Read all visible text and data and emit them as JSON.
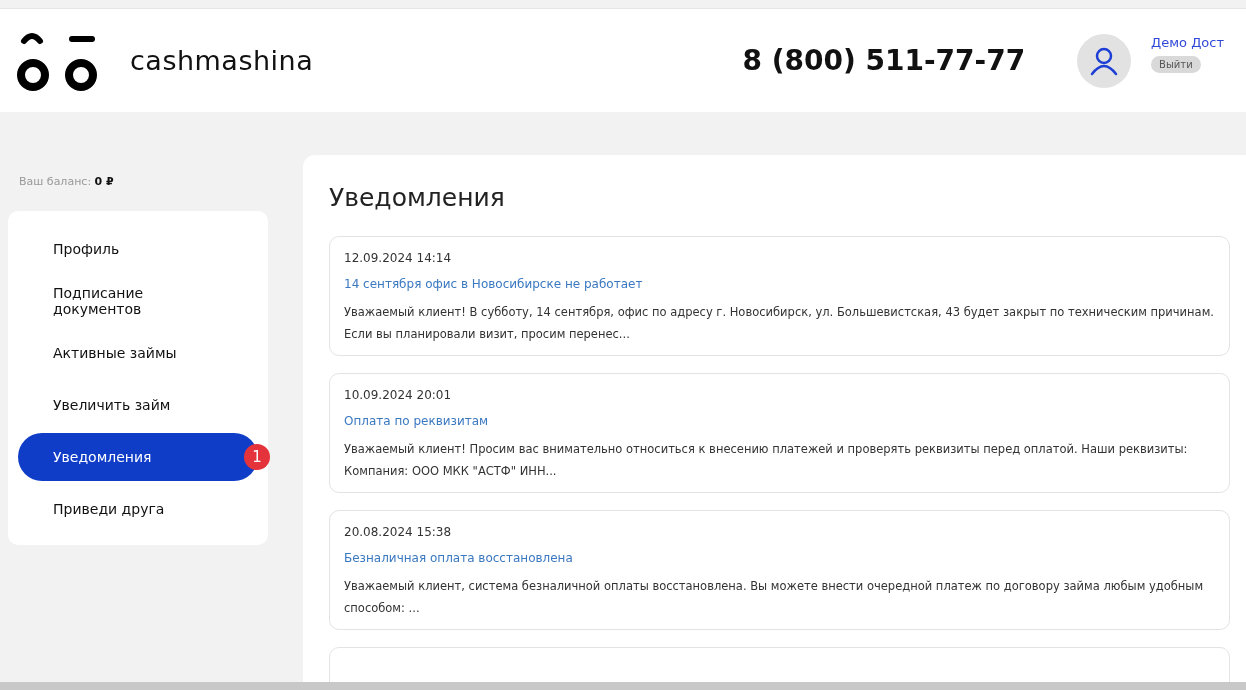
{
  "header": {
    "logo": "cashmashina",
    "phone": "8 (800) 511-77-77",
    "user": {
      "name": "Демо Дост",
      "logout": "Выйти"
    }
  },
  "balance": {
    "label": "Ваш баланс:",
    "value": "0 ₽"
  },
  "sidebar": {
    "items": [
      {
        "label": "Профиль",
        "selected": false
      },
      {
        "label": "Подписание документов",
        "selected": false
      },
      {
        "label": "Активные займы",
        "selected": false
      },
      {
        "label": "Увеличить займ",
        "selected": false
      },
      {
        "label": "Уведомления",
        "selected": true,
        "badge": "1"
      },
      {
        "label": "Приведи друга",
        "selected": false
      }
    ]
  },
  "main": {
    "title": "Уведомления",
    "notifications": [
      {
        "date": "12.09.2024 14:14",
        "title": "14 сентября офис в Новосибирске не работает",
        "text": "Уважаемый клиент! В субботу, 14 сентября, офис по адресу г. Новосибирск, ул. Большевистская, 43 будет закрыт по техническим причинам. Если вы планировали визит, просим перенес..."
      },
      {
        "date": "10.09.2024 20:01",
        "title": "Оплата по реквизитам",
        "text": "Уважаемый клиент! Просим вас внимательно относиться к внесению платежей и проверять реквизиты перед оплатой. Наши реквизиты: Компания: ООО МКК \"АСТФ\" ИНН..."
      },
      {
        "date": "20.08.2024 15:38",
        "title": "Безналичная оплата восстановлена",
        "text": "Уважаемый клиент, система безналичной оплаты восстановлена. Вы можете внести очередной платеж по договору займа любым удобным способом: ..."
      }
    ]
  }
}
